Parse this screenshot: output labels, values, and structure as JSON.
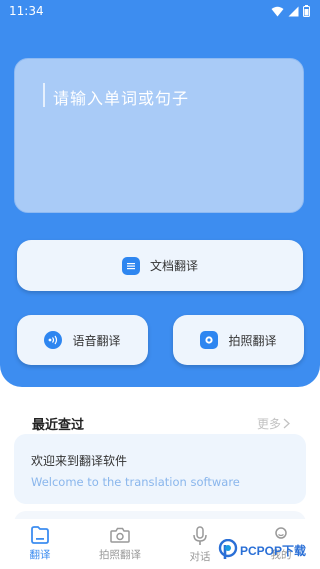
{
  "status_bar": {
    "time": "11:34"
  },
  "input": {
    "placeholder": "请输入单词或句子"
  },
  "buttons": {
    "document": "文档翻译",
    "voice": "语音翻译",
    "photo": "拍照翻译"
  },
  "recent": {
    "title": "最近查过",
    "more": "更多",
    "items": [
      {
        "source": "欢迎来到翻译软件",
        "translation": "Welcome to the translation software"
      }
    ]
  },
  "nav": [
    {
      "label": "翻译",
      "active": true
    },
    {
      "label": "拍照翻译",
      "active": false
    },
    {
      "label": "对话",
      "active": false
    },
    {
      "label": "我的",
      "active": false
    }
  ],
  "watermark": {
    "text": "PCPOP下载"
  },
  "colors": {
    "primary": "#3d8df0",
    "card": "#eef5fd",
    "input_card": "#a9cbf7"
  }
}
